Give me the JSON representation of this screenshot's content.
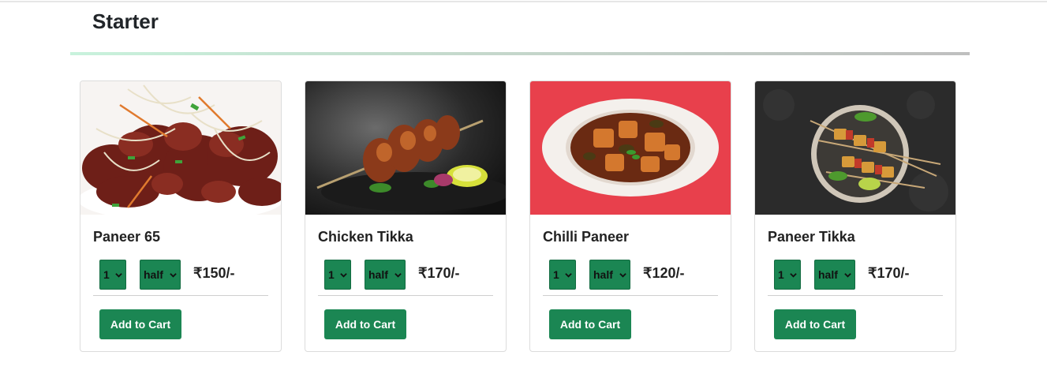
{
  "section": {
    "title": "Starter"
  },
  "items": [
    {
      "name": "Paneer 65",
      "quantity": "1",
      "portion": "half",
      "price": "₹150/-",
      "button": "Add to Cart",
      "image": "paneer-65-photo"
    },
    {
      "name": "Chicken Tikka",
      "quantity": "1",
      "portion": "half",
      "price": "₹170/-",
      "button": "Add to Cart",
      "image": "chicken-tikka-photo"
    },
    {
      "name": "Chilli Paneer",
      "quantity": "1",
      "portion": "half",
      "price": "₹120/-",
      "button": "Add to Cart",
      "image": "chilli-paneer-photo"
    },
    {
      "name": "Paneer Tikka",
      "quantity": "1",
      "portion": "half",
      "price": "₹170/-",
      "button": "Add to Cart",
      "image": "paneer-tikka-photo"
    }
  ],
  "colors": {
    "accent": "#1b8653",
    "divider_start": "#c8f2dc",
    "divider_end": "#bfbfbf"
  }
}
